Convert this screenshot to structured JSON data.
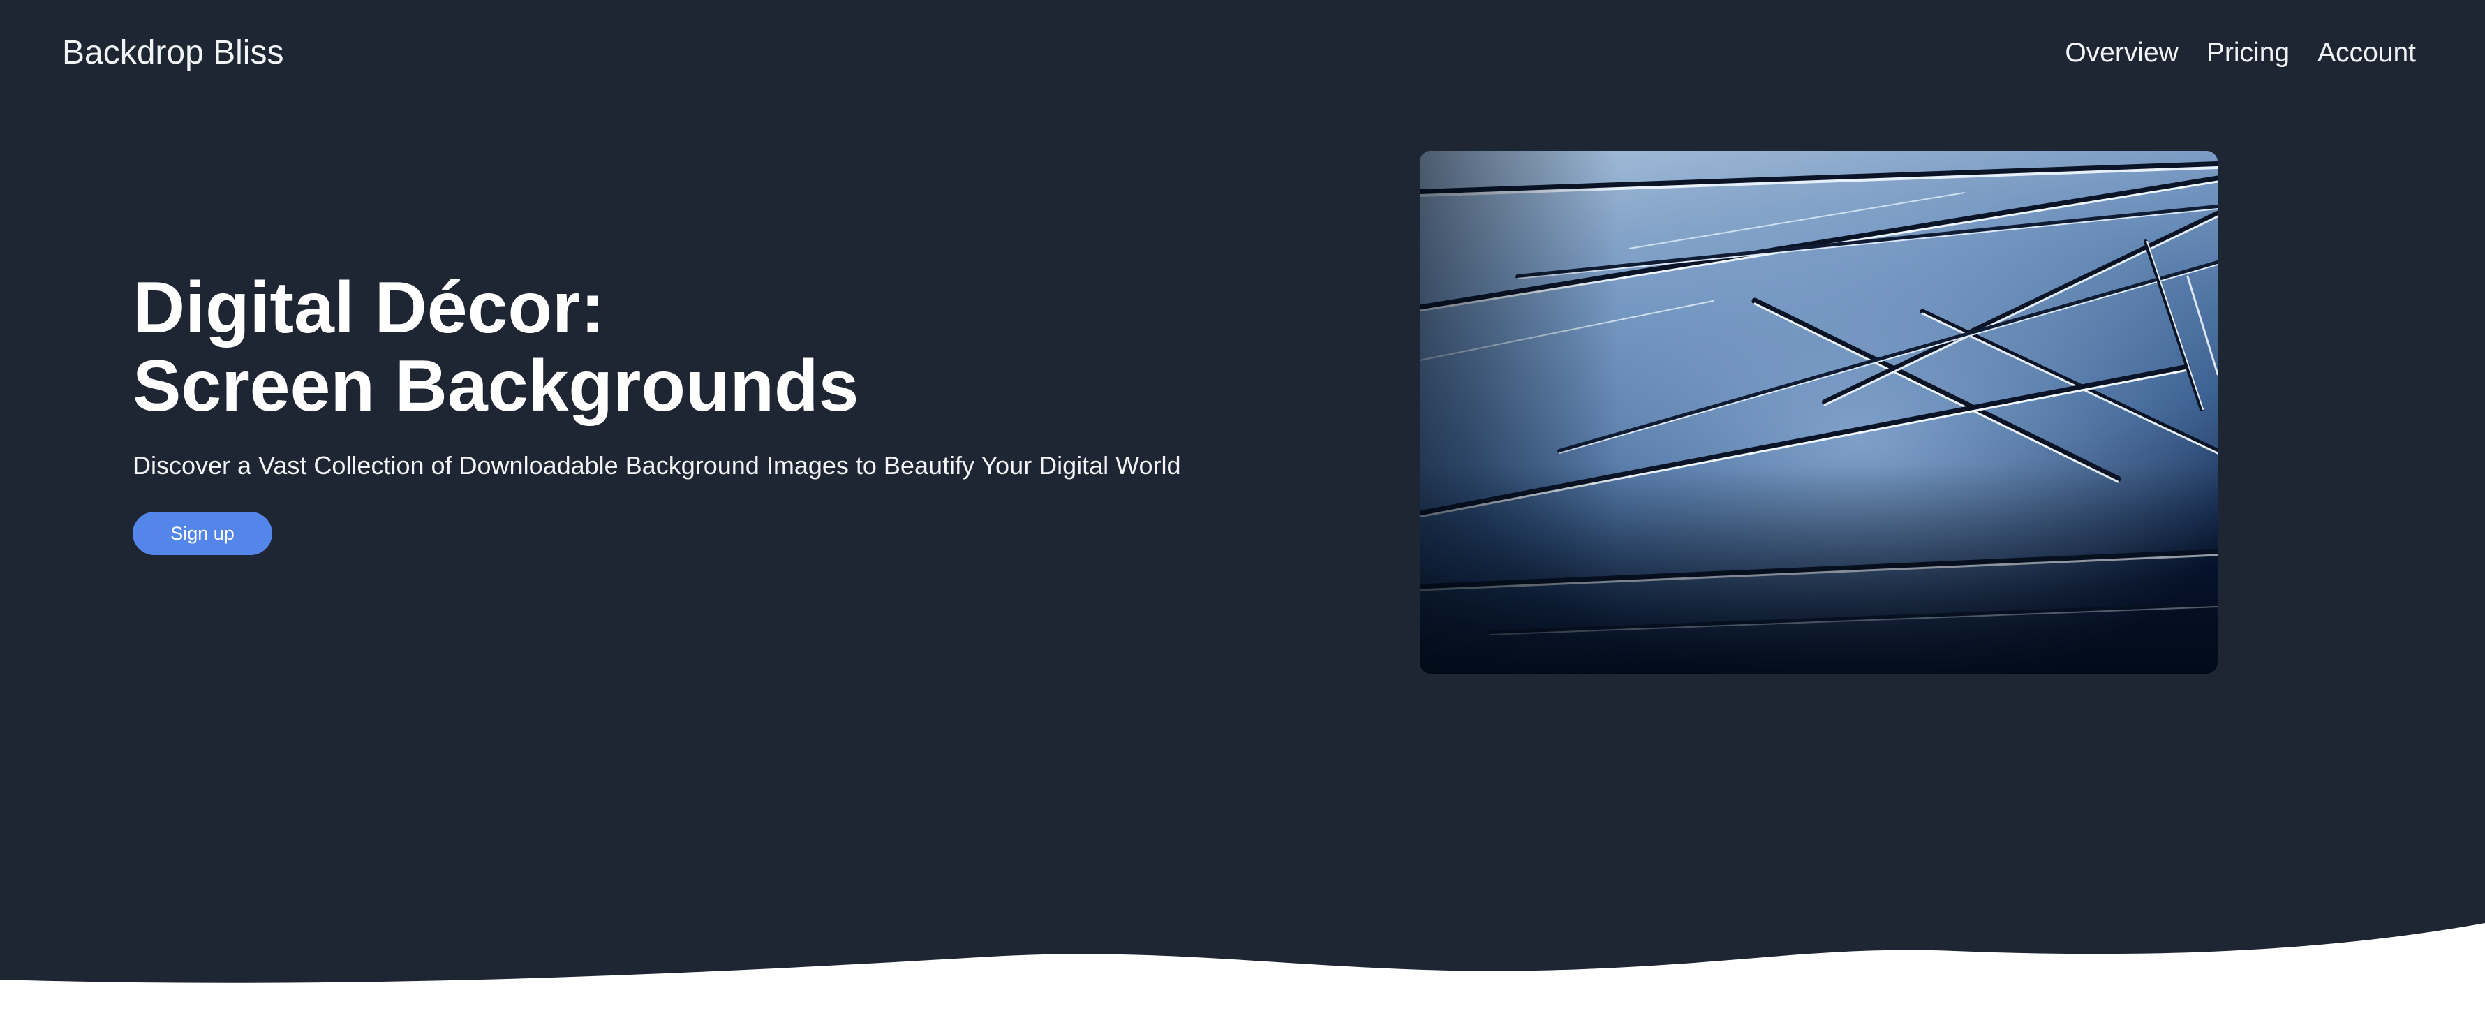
{
  "header": {
    "brand": "Backdrop Bliss",
    "nav": [
      {
        "label": "Overview"
      },
      {
        "label": "Pricing"
      },
      {
        "label": "Account"
      }
    ]
  },
  "hero": {
    "title_line1": "Digital Décor:",
    "title_line2": "Screen Backgrounds",
    "subtitle": "Discover a Vast Collection of Downloadable Background Images to Beautify Your Digital World",
    "cta_label": "Sign up"
  },
  "colors": {
    "background": "#1f2633",
    "accent": "#5486ea",
    "text": "#f2f4f7",
    "wave": "#ffffff"
  }
}
